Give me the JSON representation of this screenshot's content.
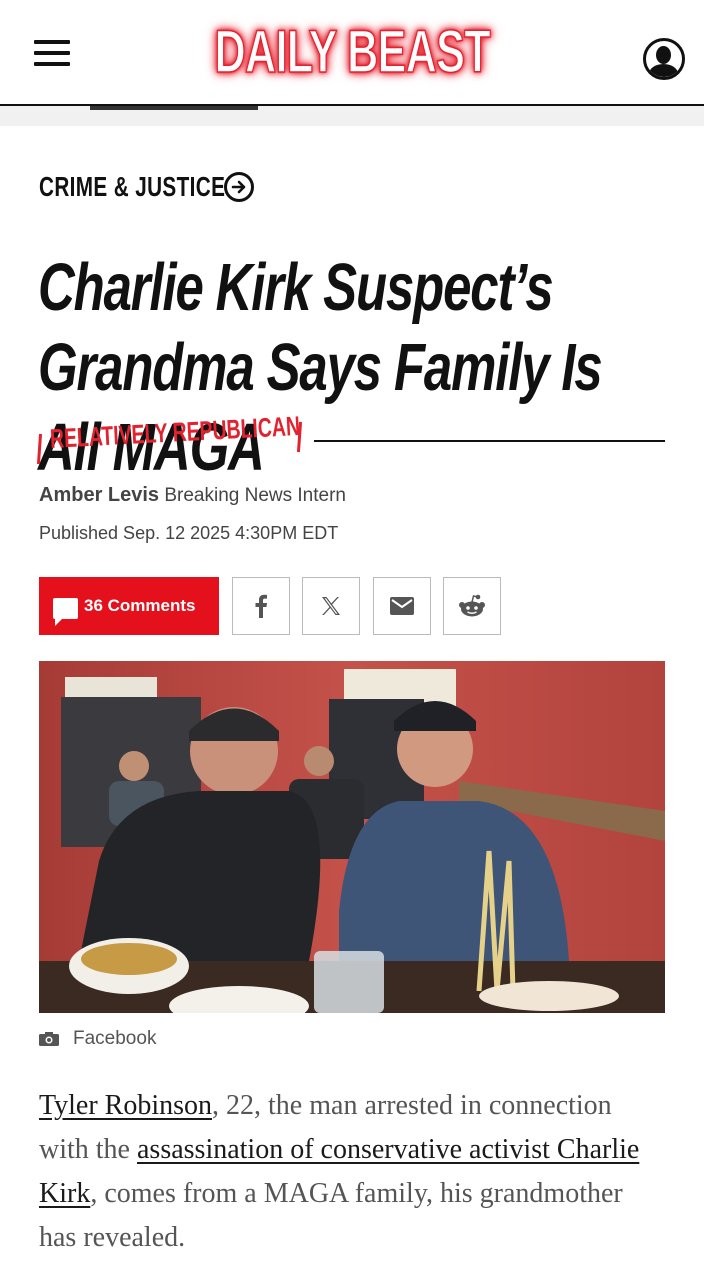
{
  "header": {
    "logo_text": "DAILY BEAST",
    "menu_icon": "hamburger-icon",
    "account_icon": "user-icon",
    "brand_color": "#e4222f"
  },
  "article": {
    "section": "CRIME & JUSTICE",
    "title": "Charlie Kirk Suspect’s Grandma Says Family Is All MAGA",
    "rubric": "RELATIVELY REPUBLICAN",
    "author": "Amber Levis",
    "author_role": "Breaking News Intern",
    "published": "Published Sep. 12 2025 4:30PM EDT",
    "comments_label": "36 Comments",
    "share_icons": [
      "facebook-icon",
      "x-icon",
      "mail-icon",
      "reddit-icon"
    ],
    "photo_credit": "Facebook",
    "body": {
      "link1": "Tyler Robinson",
      "text1": ", 22, the man arrested in connection with the ",
      "link2": "assassination of conservative activist Charlie Kirk",
      "text2": ", comes from a MAGA family, his grandmother has revealed."
    }
  }
}
